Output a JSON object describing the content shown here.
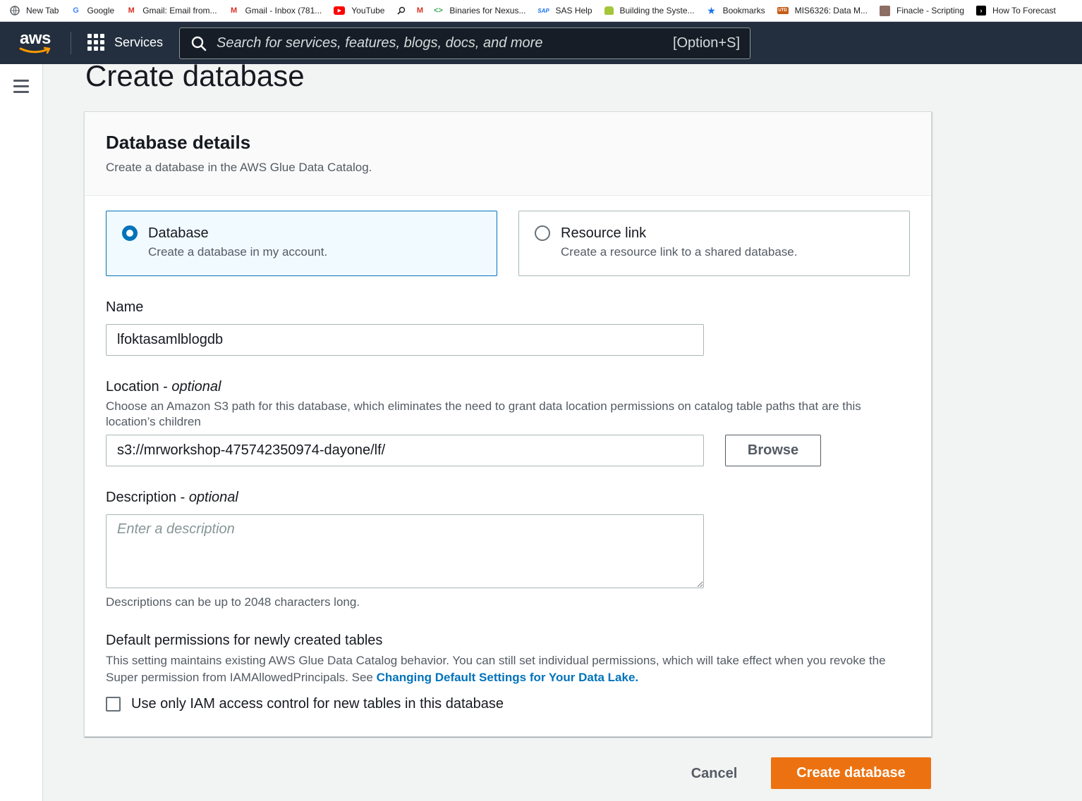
{
  "bookmarks": [
    {
      "label": "New Tab",
      "icon": "globe-icon"
    },
    {
      "label": "Google",
      "icon": "google-icon"
    },
    {
      "label": "Gmail: Email from...",
      "icon": "gmail-icon"
    },
    {
      "label": "Gmail - Inbox (781...",
      "icon": "gmail-icon"
    },
    {
      "label": "YouTube",
      "icon": "youtube-icon"
    },
    {
      "label": "",
      "icon": "search-icon"
    },
    {
      "label": "",
      "icon": "gmail-icon"
    },
    {
      "label": "Binaries for Nexus...",
      "icon": "code-icon"
    },
    {
      "label": "SAS Help",
      "icon": "sas-icon"
    },
    {
      "label": "Building the Syste...",
      "icon": "android-icon"
    },
    {
      "label": "Bookmarks",
      "icon": "star-icon"
    },
    {
      "label": "MIS6326: Data M...",
      "icon": "utd-icon"
    },
    {
      "label": "Finacle - Scripting",
      "icon": "finacle-icon"
    },
    {
      "label": "How To Forecast",
      "icon": "terminal-icon"
    }
  ],
  "nav": {
    "logo": "aws",
    "services": "Services",
    "search_placeholder": "Search for services, features, blogs, docs, and more",
    "search_shortcut": "[Option+S]"
  },
  "page": {
    "title": "Create database"
  },
  "panel": {
    "title": "Database details",
    "subtitle": "Create a database in the AWS Glue Data Catalog.",
    "tiles": [
      {
        "title": "Database",
        "desc": "Create a database in my account.",
        "selected": true
      },
      {
        "title": "Resource link",
        "desc": "Create a resource link to a shared database.",
        "selected": false
      }
    ],
    "name": {
      "label": "Name",
      "value": "lfoktasamlblogdb"
    },
    "location": {
      "label": "Location - ",
      "label_optional": "optional",
      "hint": "Choose an Amazon S3 path for this database, which eliminates the need to grant data location permissions on catalog table paths that are this location’s children",
      "value": "s3://mrworkshop-475742350974-dayone/lf/",
      "browse": "Browse"
    },
    "description": {
      "label": "Description - ",
      "label_optional": "optional",
      "placeholder": "Enter a description",
      "hint": "Descriptions can be up to 2048 characters long."
    },
    "permissions": {
      "label": "Default permissions for newly created tables",
      "hint": "This setting maintains existing AWS Glue Data Catalog behavior. You can still set individual permissions, which will take effect when you revoke the Super permission from IAMAllowedPrincipals. See ",
      "link": "Changing Default Settings for Your Data Lake.",
      "checkbox_label": "Use only IAM access control for new tables in this database",
      "checked": false
    }
  },
  "actions": {
    "cancel": "Cancel",
    "create": "Create database"
  },
  "colors": {
    "nav_bg": "#232f3e",
    "accent": "#ec7211",
    "link": "#0073bb"
  }
}
